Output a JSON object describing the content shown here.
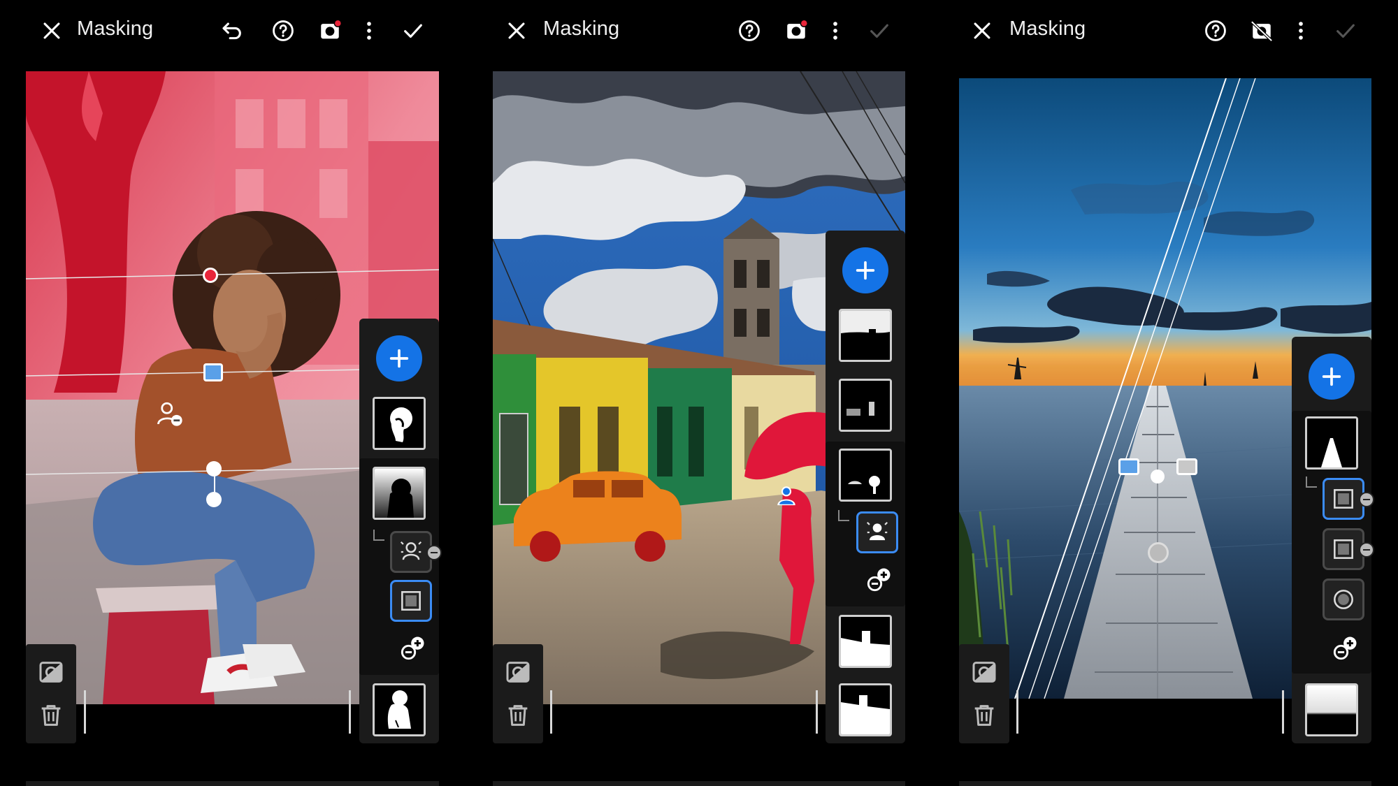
{
  "app": {
    "screen_title": "Masking"
  },
  "panels": [
    {
      "id": "portrait",
      "title": "Masking",
      "header_buttons": [
        "close",
        "undo",
        "help",
        "overlay-toggle",
        "more",
        "confirm"
      ]
    },
    {
      "id": "street",
      "title": "Masking",
      "header_buttons": [
        "close",
        "help",
        "overlay-toggle",
        "more",
        "confirm-disabled"
      ]
    },
    {
      "id": "pier",
      "title": "Masking",
      "header_buttons": [
        "close",
        "help",
        "overlay-off",
        "more",
        "confirm-disabled"
      ]
    }
  ],
  "icons": {
    "close": "close-icon",
    "undo": "undo-icon",
    "help": "help-icon",
    "overlay": "mask-overlay-icon",
    "more": "more-icon",
    "confirm": "checkmark-icon",
    "add": "plus-icon",
    "invert": "invert-mask-icon",
    "delete": "trash-icon",
    "add_subtract": "add-subtract-icon"
  },
  "colors": {
    "accent": "#1473e6",
    "selected_border": "#3b8cf5",
    "overlay_red": "#e8253a",
    "background": "#000000",
    "panel_bg": "#1b1b1b"
  }
}
